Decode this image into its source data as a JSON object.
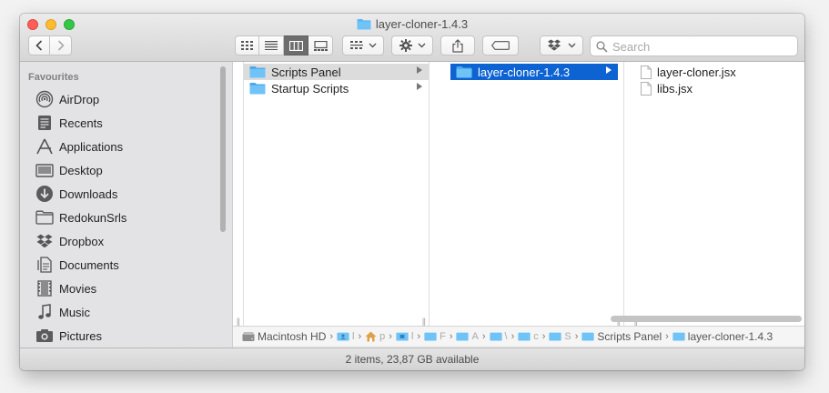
{
  "window": {
    "title": "layer-cloner-1.4.3"
  },
  "toolbar": {
    "back_icon": "chevron-left-icon",
    "forward_icon": "chevron-right-icon",
    "view_modes": [
      "icon-view",
      "list-view",
      "column-view",
      "gallery-view"
    ],
    "active_view": "column-view",
    "search_placeholder": "Search"
  },
  "sidebar": {
    "section_title": "Favourites",
    "items": [
      {
        "label": "AirDrop",
        "icon": "airdrop-icon"
      },
      {
        "label": "Recents",
        "icon": "recents-icon"
      },
      {
        "label": "Applications",
        "icon": "applications-icon"
      },
      {
        "label": "Desktop",
        "icon": "desktop-icon"
      },
      {
        "label": "Downloads",
        "icon": "downloads-icon"
      },
      {
        "label": "RedokunSrls",
        "icon": "folder-icon"
      },
      {
        "label": "Dropbox",
        "icon": "dropbox-icon"
      },
      {
        "label": "Documents",
        "icon": "documents-icon"
      },
      {
        "label": "Movies",
        "icon": "movies-icon"
      },
      {
        "label": "Music",
        "icon": "music-icon"
      },
      {
        "label": "Pictures",
        "icon": "pictures-icon"
      }
    ]
  },
  "columns": [
    {
      "items": [
        {
          "label": "Scripts Panel",
          "type": "folder",
          "state": "selected-inactive",
          "has_children": true
        },
        {
          "label": "Startup Scripts",
          "type": "folder",
          "state": "normal",
          "has_children": true
        }
      ]
    },
    {
      "items": [
        {
          "label": "layer-cloner-1.4.3",
          "type": "folder",
          "state": "selected-active",
          "has_children": true
        }
      ]
    },
    {
      "items": [
        {
          "label": "layer-cloner.jsx",
          "type": "file",
          "state": "normal"
        },
        {
          "label": "libs.jsx",
          "type": "file",
          "state": "normal"
        }
      ]
    }
  ],
  "pathbar": {
    "root": "Macintosh HD",
    "truncated": [
      "l",
      "p",
      "l",
      "F",
      "A",
      "\\",
      "c",
      "S"
    ],
    "parent": "Scripts Panel",
    "current": "layer-cloner-1.4.3"
  },
  "status": "2 items, 23,87 GB available",
  "colors": {
    "selection_active": "#0e63d3",
    "selection_inactive": "#dcdcdc",
    "folder": "#5ab6f2"
  }
}
